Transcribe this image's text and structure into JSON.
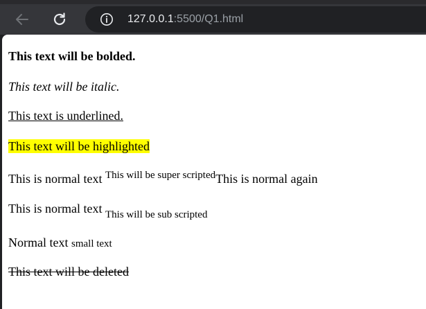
{
  "browser": {
    "url_host": "127.0.0.1",
    "url_path": ":5500/Q1.html",
    "icons": [
      "back-arrow-icon",
      "reload-icon",
      "info-icon"
    ]
  },
  "content": {
    "bold_text": "This text will be bolded.",
    "italic_text": "This text will be italic.",
    "underlined_text": "This text is underlined.",
    "highlighted_text": "This text will be highlighted",
    "superscript_line": {
      "normal_before": "This is normal text ",
      "superscript": "This will be super scripted",
      "normal_after": "This is normal again"
    },
    "subscript_line": {
      "normal_before": "This is normal text ",
      "subscript": "This will be sub scripted"
    },
    "small_line": {
      "normal": "Normal text ",
      "small": "small text"
    },
    "deleted_text": "This text will be deleted"
  },
  "colors": {
    "highlight": "#ffff00",
    "toolbar": "#35363a",
    "omnibox": "#202124"
  }
}
